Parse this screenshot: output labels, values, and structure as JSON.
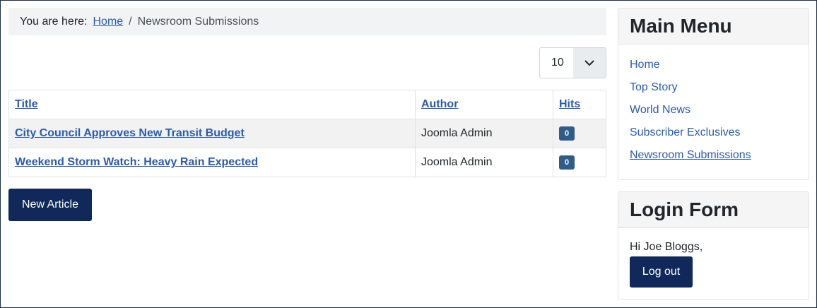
{
  "breadcrumb": {
    "prefix": "You are here:",
    "home": "Home",
    "separator": "/",
    "current": "Newsroom Submissions"
  },
  "list_limit": {
    "value": "10"
  },
  "table": {
    "headers": {
      "title": "Title",
      "author": "Author",
      "hits": "Hits"
    },
    "rows": [
      {
        "title": "City Council Approves New Transit Budget",
        "author": "Joomla Admin",
        "hits": "0"
      },
      {
        "title": "Weekend Storm Watch: Heavy Rain Expected",
        "author": "Joomla Admin",
        "hits": "0"
      }
    ]
  },
  "new_article_label": "New Article",
  "main_menu": {
    "title": "Main Menu",
    "items": [
      {
        "label": "Home"
      },
      {
        "label": "Top Story"
      },
      {
        "label": "World News"
      },
      {
        "label": "Subscriber Exclusives"
      },
      {
        "label": "Newsroom Submissions"
      }
    ]
  },
  "login_form": {
    "title": "Login Form",
    "greeting": "Hi Joe Bloggs,",
    "logout_label": "Log out"
  },
  "colors": {
    "link": "#2a5bb0",
    "primary_button": "#10295a",
    "badge": "#2f5d8a"
  }
}
